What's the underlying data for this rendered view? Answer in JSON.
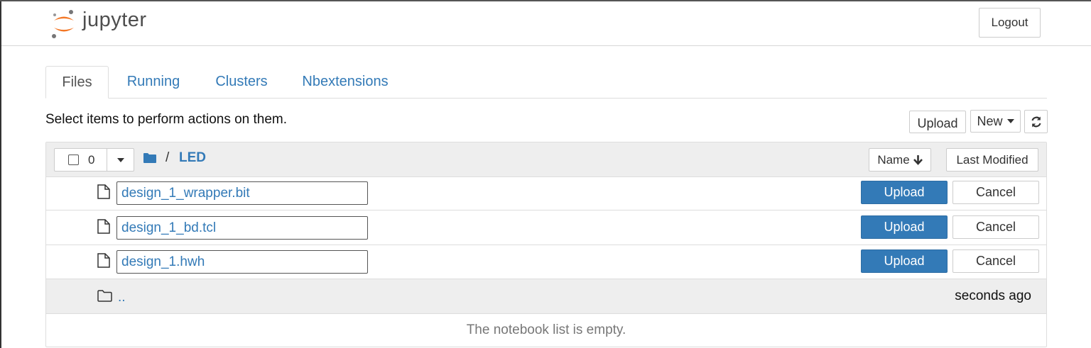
{
  "header": {
    "logo_text": "jupyter",
    "logout_label": "Logout"
  },
  "tabs": [
    {
      "label": "Files",
      "active": true
    },
    {
      "label": "Running",
      "active": false
    },
    {
      "label": "Clusters",
      "active": false
    },
    {
      "label": "Nbextensions",
      "active": false
    }
  ],
  "toolbar": {
    "hint": "Select items to perform actions on them.",
    "upload_label": "Upload",
    "new_label": "New"
  },
  "list": {
    "selected_count": "0",
    "breadcrumb_sep": "/",
    "current_folder": "LED",
    "sort_name_label": "Name",
    "sort_modified_label": "Last Modified",
    "pending_uploads": [
      {
        "filename": "design_1_wrapper.bit",
        "upload_label": "Upload",
        "cancel_label": "Cancel"
      },
      {
        "filename": "design_1_bd.tcl",
        "upload_label": "Upload",
        "cancel_label": "Cancel"
      },
      {
        "filename": "design_1.hwh",
        "upload_label": "Upload",
        "cancel_label": "Cancel"
      }
    ],
    "parent": {
      "name": "..",
      "modified": "seconds ago"
    },
    "empty_message": "The notebook list is empty."
  },
  "colors": {
    "link": "#337ab7",
    "primary_button": "#337ab7",
    "logo_orange": "#f37726"
  },
  "icons": [
    "jupyter-logo-icon",
    "folder-icon",
    "file-icon",
    "refresh-icon",
    "arrow-down-icon",
    "caret-down-icon"
  ]
}
